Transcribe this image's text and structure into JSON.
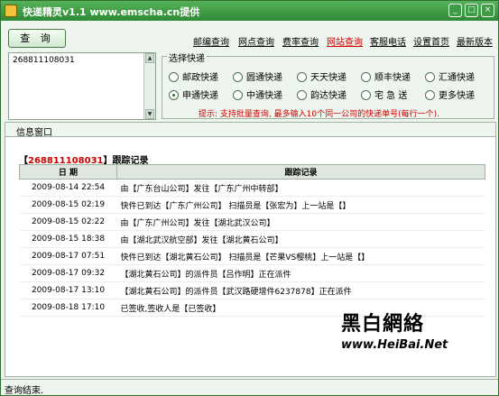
{
  "titlebar": {
    "title": "快递精灵v1.1 www.emscha.cn提供",
    "min": "_",
    "max": "□",
    "close": "×"
  },
  "toolbar": {
    "query_label": "查 询"
  },
  "topnav": {
    "items": [
      "邮编查询",
      "网点查询",
      "费率查询",
      "网站查询",
      "客服电话",
      "设置首页",
      "最新版本"
    ]
  },
  "input": {
    "value": "268811108031"
  },
  "express": {
    "title": "选择快递",
    "options": [
      "邮政快递",
      "圆通快递",
      "天天快递",
      "顺丰快递",
      "汇通快递",
      "申通快递",
      "中通快递",
      "韵达快递",
      "宅 急 送",
      "更多快递"
    ],
    "selected": "申通快递",
    "hint": "提示: 支持批量查询, 最多输入10个同一公司的快递单号(每行一个)."
  },
  "info": {
    "tab": "信息窗口",
    "head_prefix": "【",
    "number": "268811108031",
    "head_suffix": "】跟踪记录",
    "col_date": "日 期",
    "col_record": "跟踪记录"
  },
  "rows": [
    {
      "date": "2009-08-14 22:54",
      "text": "由【广东台山公司】发往【广东广州中转部】"
    },
    {
      "date": "2009-08-15 02:19",
      "text": "快件已到达【广东广州公司】 扫描员是【张宏为】上一站是【】"
    },
    {
      "date": "2009-08-15 02:22",
      "text": "由【广东广州公司】发往【湖北武汉公司】"
    },
    {
      "date": "2009-08-15 18:38",
      "text": "由【湖北武汉航空部】发往【湖北黄石公司】"
    },
    {
      "date": "2009-08-17 07:51",
      "text": "快件已到达【湖北黄石公司】 扫描员是【芒果VS樱桃】上一站是【】"
    },
    {
      "date": "2009-08-17 09:32",
      "text": "【湖北黄石公司】的派件员【吕作明】正在派件"
    },
    {
      "date": "2009-08-17 13:10",
      "text": "【湖北黄石公司】的派件员【武汉路硬增件6237878】正在派件"
    },
    {
      "date": "2009-08-18 17:10",
      "text": "已签收,签收人是【已签收】"
    }
  ],
  "watermark": {
    "chars": "黑白網絡",
    "url": "www.HeiBai.Net"
  },
  "status": {
    "text": "查询结束."
  },
  "colors": {
    "title_green": "#2e8a34",
    "accent_red": "#d00000",
    "link_blue": "#2030a0"
  }
}
